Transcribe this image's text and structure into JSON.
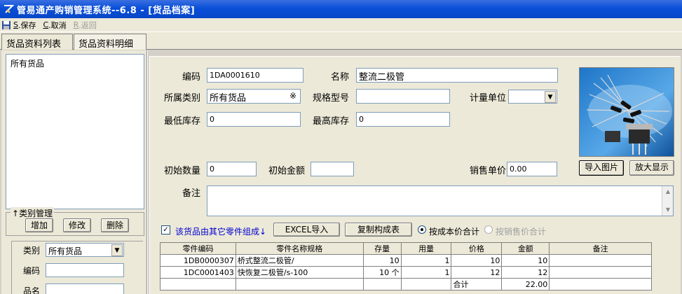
{
  "window": {
    "title": "管易通产购销管理系统--6.8 - [货品档案]"
  },
  "toolbar": {
    "save": {
      "key": "S",
      "label": ".保存"
    },
    "cancel": {
      "key": "C",
      "label": ".取消"
    },
    "back": {
      "key": "R",
      "label": ".返回"
    }
  },
  "tabs": [
    "货品资料列表",
    "货品资料明细"
  ],
  "left": {
    "tree_root": "所有货品",
    "category_group": "类别管理",
    "buttons": {
      "add": "增加",
      "edit": "修改",
      "delete": "删除"
    },
    "filter": {
      "category_label": "类别",
      "category_value": "所有货品",
      "code_label": "编码",
      "name_label": "品名"
    }
  },
  "form": {
    "code_label": "编码",
    "code": "1DA0001610",
    "name_label": "名称",
    "name": "整流二极管",
    "category_label": "所属类别",
    "category": "所有货品",
    "spec_label": "规格型号",
    "spec": "",
    "unit_label": "计量单位",
    "unit": "",
    "min_stock_label": "最低库存",
    "min_stock": "0",
    "max_stock_label": "最高库存",
    "max_stock": "0",
    "init_qty_label": "初始数量",
    "init_qty": "0",
    "init_amount_label": "初始金额",
    "init_amount": "",
    "sale_price_label": "销售单价",
    "sale_price": "0.00",
    "remark_label": "备注",
    "remark": "",
    "import_image": "导入图片",
    "zoom": "放大显示",
    "picker_icon": "※"
  },
  "composition": {
    "checkbox_label": "该货品由其它零件组成↓",
    "checked": true,
    "excel_import": "EXCEL导入",
    "copy_composition": "复制构成表",
    "radio_cost": "按成本价合计",
    "radio_sale": "按销售价合计",
    "columns": [
      "零件编码",
      "零件名称规格",
      "存量",
      "用量",
      "价格",
      "金额",
      "备注"
    ],
    "rows": [
      {
        "code": "1DB0000307",
        "name": "桥式整流二极管/",
        "stock": "10",
        "usage": "1",
        "price": "10",
        "amount": "10",
        "note": ""
      },
      {
        "code": "1DC0001403",
        "name": "快恢复二极管/s-100",
        "stock": "10 个",
        "usage": "1",
        "price": "12",
        "amount": "12",
        "note": ""
      }
    ],
    "total_label": "合计",
    "total": "22.00"
  }
}
